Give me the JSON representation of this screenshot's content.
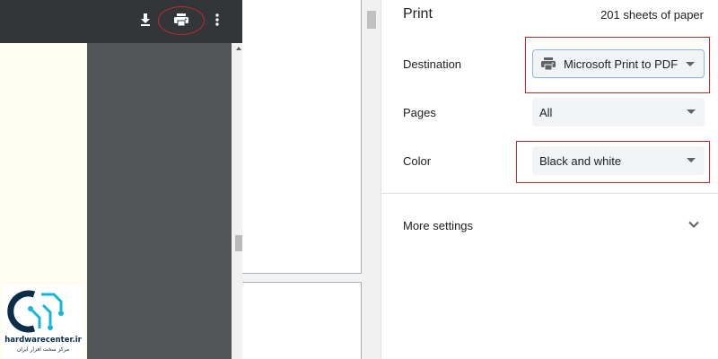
{
  "pdf_viewer": {
    "toolbar_icons": [
      "download-icon",
      "print-icon",
      "more-vert-icon"
    ]
  },
  "logo": {
    "name": "hardwarecenter.ir",
    "tagline": "مرکز سخت افزار ایران"
  },
  "print_panel": {
    "title": "Print",
    "sheets": "201 sheets of paper",
    "destination": {
      "label": "Destination",
      "value": "Microsoft Print to PDF",
      "icon": "printer-icon"
    },
    "pages": {
      "label": "Pages",
      "value": "All"
    },
    "color": {
      "label": "Color",
      "value": "Black and white"
    },
    "more_settings": {
      "label": "More settings",
      "icon": "chevron-down-icon"
    }
  },
  "colors": {
    "viewer_bg": "#525659",
    "toolbar_bg": "#323639",
    "highlight": "#c62828",
    "select_bg": "#f1f3f4",
    "focus_border": "#8ab4f8"
  }
}
